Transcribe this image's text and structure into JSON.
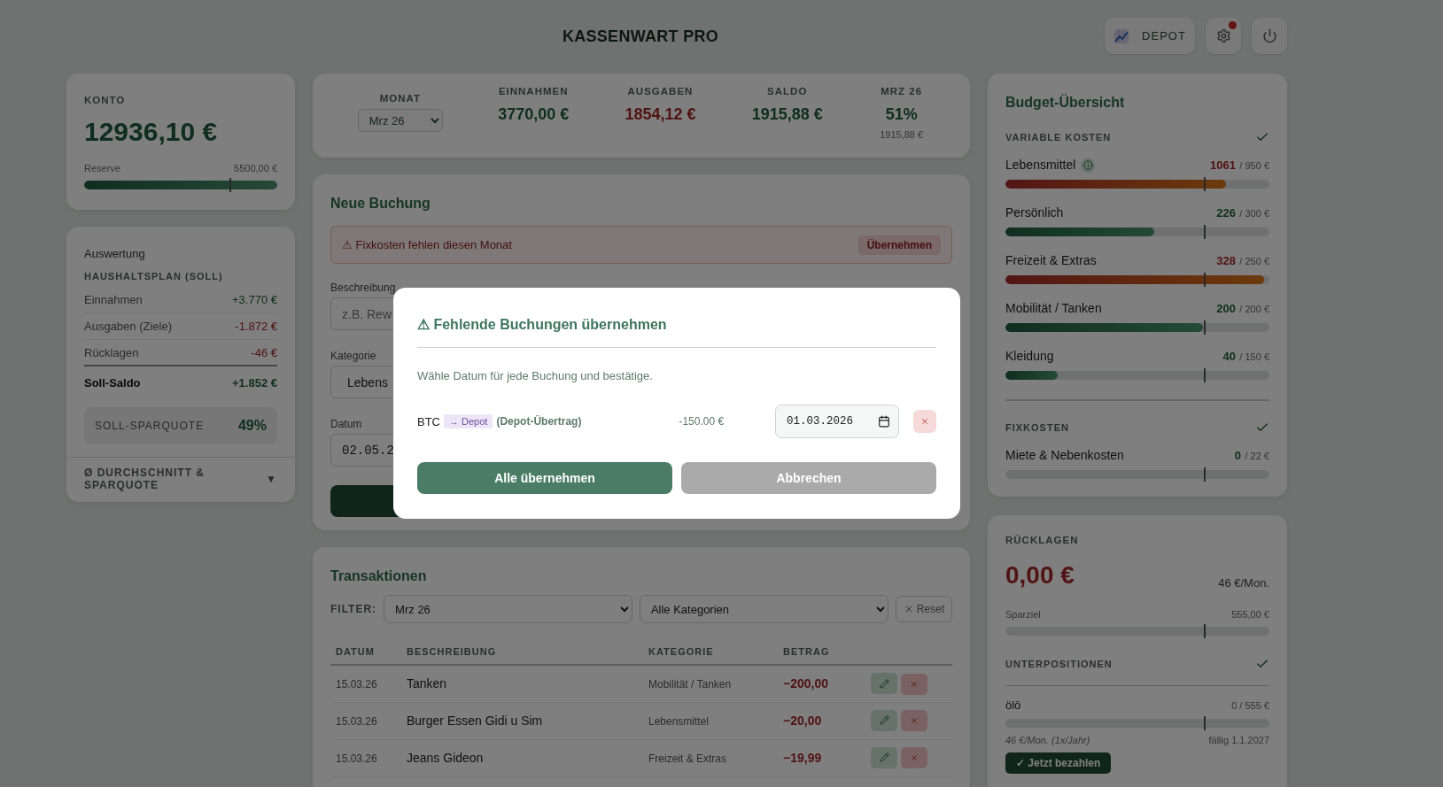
{
  "header": {
    "title": "KASSENWART PRO",
    "depot_button": "DEPOT",
    "settings_notification": true
  },
  "konto": {
    "label": "KONTO",
    "balance": "12936,10 €",
    "reserve_label": "Reserve",
    "reserve_value": "5500,00 €",
    "level": 1
  },
  "auswertung": {
    "title": "Auswertung",
    "section": "HAUSHALTSPLAN (SOLL)",
    "rows": [
      {
        "label": "Einnahmen",
        "value": "+3.770 €",
        "negative": false
      },
      {
        "label": "Ausgaben (Ziele)",
        "value": "-1.872 €",
        "negative": true
      },
      {
        "label": "Rücklagen",
        "value": "-46 €",
        "negative": true
      }
    ],
    "total": {
      "label": "Soll-Saldo",
      "value": "+1.852 €",
      "negative": false
    },
    "sparquote": {
      "label": "SOLL-SPARQUOTE",
      "value": "49%"
    },
    "collapse": {
      "label": "Ø DURCHSCHNITT & SPARQUOTE",
      "toggle": "▼",
      "expanded": false
    }
  },
  "summary": {
    "month": {
      "label": "MONAT",
      "value": "Mrz 26"
    },
    "stats": [
      {
        "label": "EINNAHMEN",
        "value": "3770,00 €",
        "negative": false
      },
      {
        "label": "AUSGABEN",
        "value": "1854,12 €",
        "negative": true
      },
      {
        "label": "SALDO",
        "value": "1915,88 €",
        "negative": false
      },
      {
        "label": "MRZ 26",
        "value": "51%",
        "negative": false,
        "sub": "1915,88 €"
      }
    ]
  },
  "neue_buchung": {
    "title": "Neue Buchung",
    "alert": {
      "text": "⚠ Fixkosten fehlen diesen Monat",
      "button": "Übernehmen"
    },
    "fields": [
      {
        "kind": "text",
        "label": "Beschreibung",
        "placeholder": "z.B. Rew"
      },
      {
        "kind": "select",
        "label": "Kategorie",
        "value": "Lebens"
      },
      {
        "kind": "date",
        "label": "Datum",
        "value": "02.05.2"
      }
    ]
  },
  "transaktionen": {
    "title": "Transaktionen",
    "filter_label": "FILTER:",
    "month_filter": "Mrz 26",
    "category_filter": "Alle Kategorien",
    "reset": "Reset",
    "columns": [
      "DATUM",
      "BESCHREIBUNG",
      "KATEGORIE",
      "BETRAG"
    ],
    "rows": [
      {
        "date": "15.03.26",
        "description": "Tanken",
        "category": "Mobilität / Tanken",
        "amount": "−200,00"
      },
      {
        "date": "15.03.26",
        "description": "Burger Essen Gidi u Sim",
        "category": "Lebensmittel",
        "amount": "−20,00"
      },
      {
        "date": "15.03.26",
        "description": "Jeans Gideon",
        "category": "Freizeit & Extras",
        "amount": "−19,99"
      }
    ]
  },
  "budget": {
    "title": "Budget-Übersicht",
    "sections": [
      {
        "title": "VARIABLE KOSTEN",
        "complete": true,
        "items": [
          {
            "name": "Lebensmittel",
            "info": true,
            "spent": "1061",
            "limit": "/ 950 €",
            "over": true,
            "level": 0.835
          },
          {
            "name": "Persönlich",
            "info": false,
            "spent": "226",
            "limit": "/ 300 €",
            "over": false,
            "level": 0.564
          },
          {
            "name": "Freizeit & Extras",
            "info": false,
            "spent": "328",
            "limit": "/ 250 €",
            "over": true,
            "level": 0.98
          },
          {
            "name": "Mobilität / Tanken",
            "info": false,
            "spent": "200",
            "limit": "/ 200 €",
            "over": false,
            "level": 0.748
          },
          {
            "name": "Kleidung",
            "info": false,
            "spent": "40",
            "limit": "/ 150 €",
            "over": false,
            "level": 0.198
          }
        ]
      },
      {
        "title": "FIXKOSTEN",
        "complete": true,
        "items": [
          {
            "name": "Miete & Nebenkosten",
            "info": false,
            "spent": "0",
            "limit": "/ 22 €",
            "over": false
          }
        ]
      }
    ]
  },
  "ruecklagen": {
    "title": "RÜCKLAGEN",
    "balance": "0,00 €",
    "monthly": "46 €/Mon.",
    "goal_label": "Sparziel",
    "goal_value": "555,00 €",
    "sub_title": "UNTERPOSITIONEN",
    "sub_complete": true,
    "items": [
      {
        "name": "ölö",
        "amount": "0 / 555 €",
        "rate": "46 €/Mon. (1x/Jahr)",
        "due": "fällig 1.1.2027",
        "button": "✓ Jetzt bezahlen"
      }
    ]
  },
  "modal": {
    "title": "⚠ Fehlende Buchungen übernehmen",
    "hint": "Wähle Datum für jede Buchung und bestätige.",
    "items": [
      {
        "name": "BTC",
        "tag": "→ Depot",
        "category": "(Depot-Übertrag)",
        "amount": "-150.00 €",
        "date": "01.03.2026"
      }
    ],
    "confirm": "Alle übernehmen",
    "cancel": "Abbrechen"
  }
}
